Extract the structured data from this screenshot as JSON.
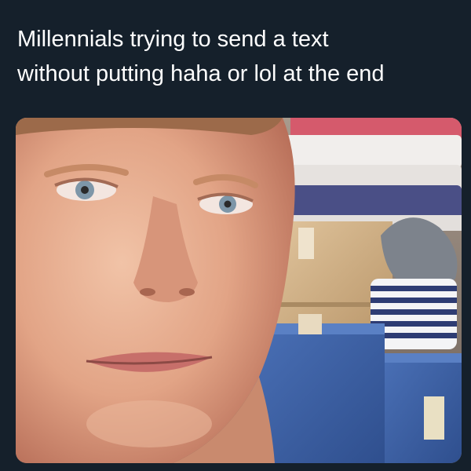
{
  "meme": {
    "caption_lines": [
      "Millennials trying to send a text",
      "without putting haha or lol at the end"
    ],
    "photo_subject": "selfie"
  },
  "colors": {
    "background": "#15202b",
    "text": "#ffffff",
    "skin": "#e3a98c",
    "box_blue": "#3f63a8",
    "cardboard": "#d2b48a"
  }
}
